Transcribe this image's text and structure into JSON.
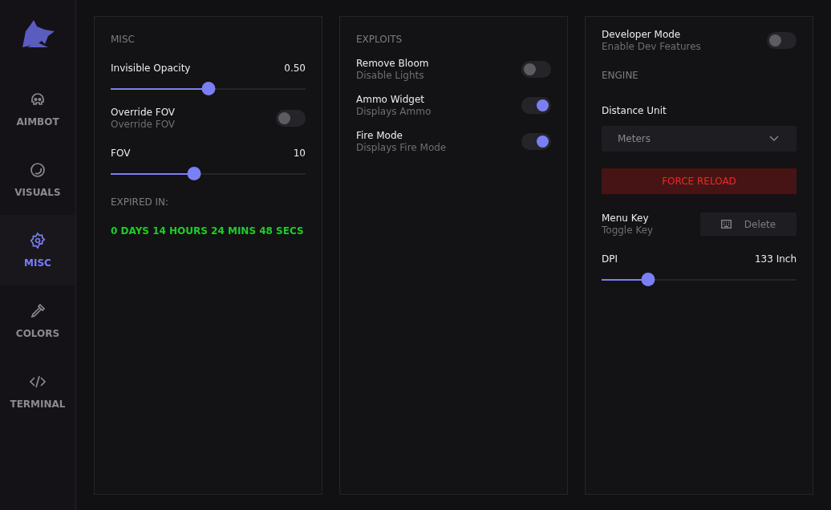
{
  "sidebar": {
    "items": [
      {
        "label": "AIMBOT",
        "selected": false
      },
      {
        "label": "VISUALS",
        "selected": false
      },
      {
        "label": "MISC",
        "selected": true
      },
      {
        "label": "COLORS",
        "selected": false
      },
      {
        "label": "TERMINAL",
        "selected": false
      }
    ]
  },
  "panels": [
    {
      "items": [
        {
          "kind": "heading",
          "text": "MISC"
        },
        {
          "kind": "slider",
          "label": "Invisible Opacity",
          "reading": "0.50",
          "level": 0.5
        },
        {
          "kind": "toggle",
          "label": "Override FOV",
          "sub": "Override FOV",
          "on": false
        },
        {
          "kind": "slider",
          "label": "FOV",
          "reading": "10",
          "level": 0.43
        },
        {
          "kind": "heading",
          "text": "EXPIRED IN:"
        },
        {
          "kind": "timer",
          "text": "0 DAYS 14 HOURS 24 MINS 48 SECS"
        }
      ]
    },
    {
      "items": [
        {
          "kind": "heading",
          "text": "EXPLOITS"
        },
        {
          "kind": "toggle",
          "label": "Remove Bloom",
          "sub": "Disable Lights",
          "on": false
        },
        {
          "kind": "toggle",
          "label": "Ammo Widget",
          "sub": "Displays Ammo",
          "on": true
        },
        {
          "kind": "toggle",
          "label": "Fire Mode",
          "sub": "Displays Fire Mode",
          "on": true
        }
      ]
    },
    {
      "items": [
        {
          "kind": "toggle",
          "label": "Developer Mode",
          "sub": "Enable Dev Features",
          "on": false
        },
        {
          "kind": "heading",
          "text": "ENGINE"
        },
        {
          "kind": "label",
          "text": "Distance Unit"
        },
        {
          "kind": "dropdown",
          "value": "Meters"
        },
        {
          "kind": "button",
          "text": "FORCE RELOAD"
        },
        {
          "kind": "keybind",
          "label": "Menu Key",
          "sub": "Toggle Key",
          "key": "Delete"
        },
        {
          "kind": "slider",
          "label": "DPI",
          "reading": "133 Inch",
          "level": 0.24
        }
      ]
    }
  ]
}
